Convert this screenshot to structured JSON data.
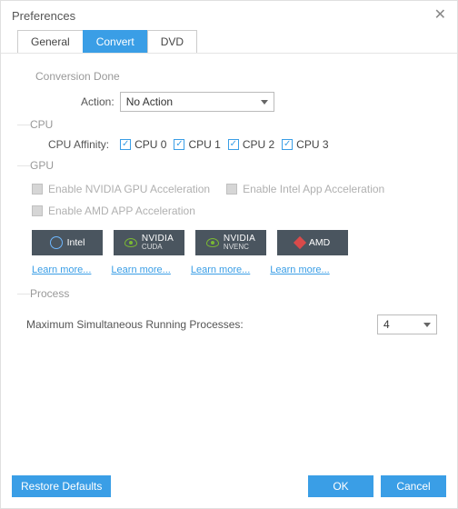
{
  "title": "Preferences",
  "tabs": [
    "General",
    "Convert",
    "DVD"
  ],
  "active_tab": "Convert",
  "sections": {
    "conversion_done": {
      "title": "Conversion Done",
      "action_label": "Action:",
      "action_value": "No Action"
    },
    "cpu": {
      "title": "CPU",
      "affinity_label": "CPU Affinity:",
      "cpus": [
        "CPU 0",
        "CPU 1",
        "CPU 2",
        "CPU 3"
      ],
      "checked": [
        true,
        true,
        true,
        true
      ]
    },
    "gpu": {
      "title": "GPU",
      "options": [
        "Enable NVIDIA GPU Acceleration",
        "Enable Intel App Acceleration",
        "Enable AMD APP Acceleration"
      ],
      "options_enabled": [
        false,
        false,
        false
      ],
      "badges": [
        {
          "label": "Intel"
        },
        {
          "line1": "NVIDIA",
          "line2": "CUDA"
        },
        {
          "line1": "NVIDIA",
          "line2": "NVENC"
        },
        {
          "label": "AMD"
        }
      ],
      "learn_more": [
        "Learn more...",
        "Learn more...",
        "Learn more...",
        "Learn more..."
      ]
    },
    "process": {
      "title": "Process",
      "max_label": "Maximum Simultaneous Running Processes:",
      "max_value": "4"
    }
  },
  "footer": {
    "restore": "Restore Defaults",
    "ok": "OK",
    "cancel": "Cancel"
  },
  "colors": {
    "accent": "#3a9ee6",
    "badge_bg": "#4a555f",
    "disabled_text": "#b0b0b0"
  }
}
